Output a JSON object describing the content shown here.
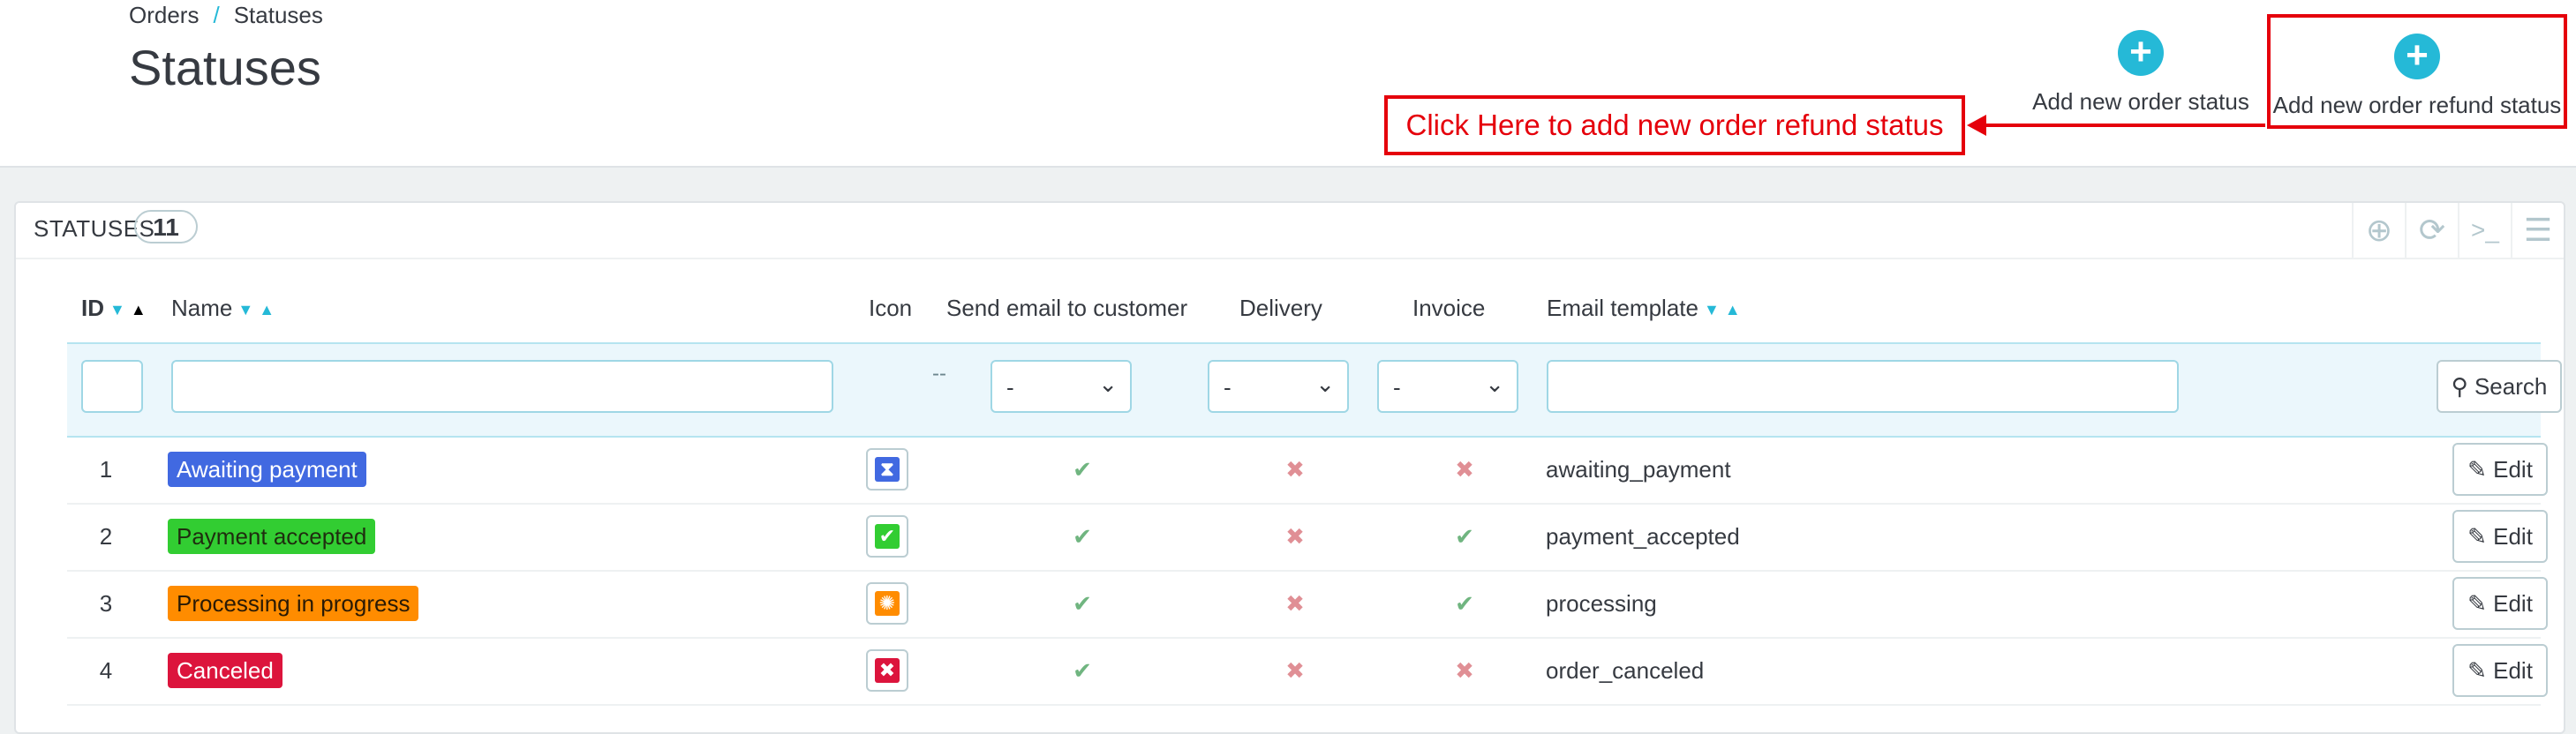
{
  "breadcrumb": {
    "parent": "Orders",
    "separator": "/",
    "current": "Statuses"
  },
  "page_title": "Statuses",
  "toolbar": {
    "add_status_label": "Add new order status",
    "add_refund_label": "Add new order refund status"
  },
  "annotation": {
    "callout_text": "Click Here to add new order refund status",
    "color": "#e5000b"
  },
  "panel": {
    "title": "STATUSES",
    "count": "11"
  },
  "table": {
    "headers": {
      "id": "ID",
      "name": "Name",
      "icon": "Icon",
      "send_email": "Send email to customer",
      "delivery": "Delivery",
      "invoice": "Invoice",
      "email_template": "Email template"
    },
    "filters": {
      "icon_placeholder": "--",
      "send_email_selected": "-",
      "delivery_selected": "-",
      "invoice_selected": "-",
      "search_label": "Search"
    },
    "edit_label": "Edit",
    "rows": [
      {
        "id": "1",
        "name": "Awaiting payment",
        "color": "#4169e1",
        "icon": "hourglass-icon",
        "send_email": true,
        "delivery": false,
        "invoice": false,
        "template": "awaiting_payment"
      },
      {
        "id": "2",
        "name": "Payment accepted",
        "color": "#32cd32",
        "icon": "check-square-icon",
        "send_email": true,
        "delivery": false,
        "invoice": true,
        "template": "payment_accepted"
      },
      {
        "id": "3",
        "name": "Processing in progress",
        "color": "#ff8c00",
        "icon": "processing-icon",
        "send_email": true,
        "delivery": false,
        "invoice": true,
        "template": "processing"
      },
      {
        "id": "4",
        "name": "Canceled",
        "color": "#dc143c",
        "icon": "cancel-icon",
        "send_email": true,
        "delivery": false,
        "invoice": false,
        "template": "order_canceled"
      }
    ]
  }
}
